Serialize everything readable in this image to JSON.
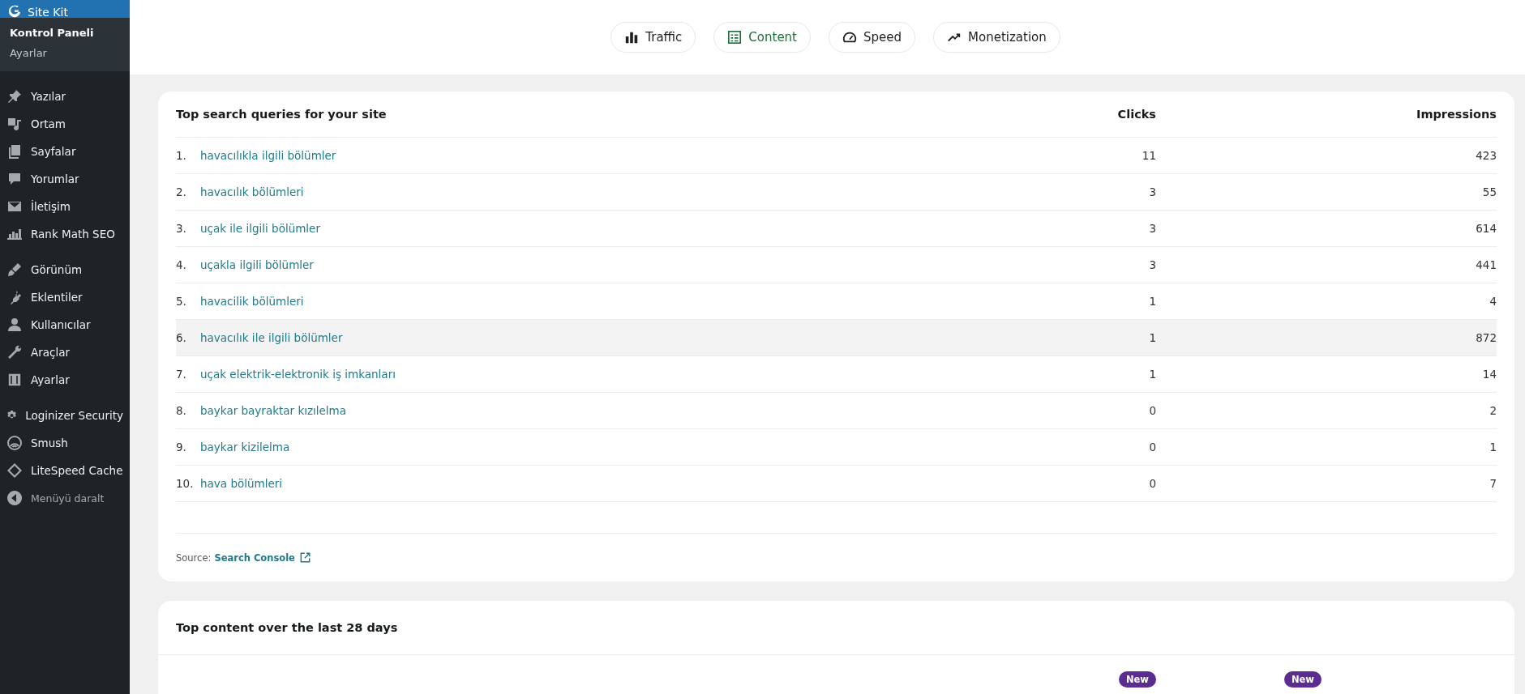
{
  "sidebar": {
    "plugin": {
      "label": "Site Kit",
      "selected": true
    },
    "submenu": [
      {
        "label": "Kontrol Paneli",
        "selected": true
      },
      {
        "label": "Ayarlar",
        "selected": false
      }
    ],
    "groups": [
      [
        "Yazılar",
        "Ortam",
        "Sayfalar",
        "Yorumlar",
        "İletişim",
        "Rank Math SEO"
      ],
      [
        "Görünüm",
        "Eklentiler",
        "Kullanıcılar",
        "Araçlar",
        "Ayarlar"
      ],
      [
        "Loginizer Security",
        "Smush",
        "LiteSpeed Cache"
      ]
    ],
    "collapse": "Menüyü daralt"
  },
  "tabs": [
    {
      "label": "Traffic",
      "selected": false
    },
    {
      "label": "Content",
      "selected": true
    },
    {
      "label": "Speed",
      "selected": false
    },
    {
      "label": "Monetization",
      "selected": false
    }
  ],
  "queries": {
    "title": "Top search queries for your site",
    "columns": [
      "Clicks",
      "Impressions"
    ],
    "rows": [
      {
        "rank": "1.",
        "query": "havacılıkla ilgili bölümler",
        "clicks": "11",
        "impressions": "423",
        "highlighted": false
      },
      {
        "rank": "2.",
        "query": "havacılık bölümleri",
        "clicks": "3",
        "impressions": "55",
        "highlighted": false
      },
      {
        "rank": "3.",
        "query": "uçak ile ilgili bölümler",
        "clicks": "3",
        "impressions": "614",
        "highlighted": false
      },
      {
        "rank": "4.",
        "query": "uçakla ilgili bölümler",
        "clicks": "3",
        "impressions": "441",
        "highlighted": false
      },
      {
        "rank": "5.",
        "query": "havacilik bölümleri",
        "clicks": "1",
        "impressions": "4",
        "highlighted": false
      },
      {
        "rank": "6.",
        "query": "havacılık ile ilgili bölümler",
        "clicks": "1",
        "impressions": "872",
        "highlighted": true
      },
      {
        "rank": "7.",
        "query": "uçak elektrik-elektronik iş imkanları",
        "clicks": "1",
        "impressions": "14",
        "highlighted": false
      },
      {
        "rank": "8.",
        "query": "baykar bayraktar kızılelma",
        "clicks": "0",
        "impressions": "2",
        "highlighted": false
      },
      {
        "rank": "9.",
        "query": "baykar kizilelma",
        "clicks": "0",
        "impressions": "1",
        "highlighted": false
      },
      {
        "rank": "10.",
        "query": "hava bölümleri",
        "clicks": "0",
        "impressions": "7",
        "highlighted": false
      }
    ],
    "source_label": "Source:",
    "source_link": "Search Console"
  },
  "top_content": {
    "title": "Top content over the last 28 days",
    "badges": [
      "New",
      "New"
    ]
  }
}
